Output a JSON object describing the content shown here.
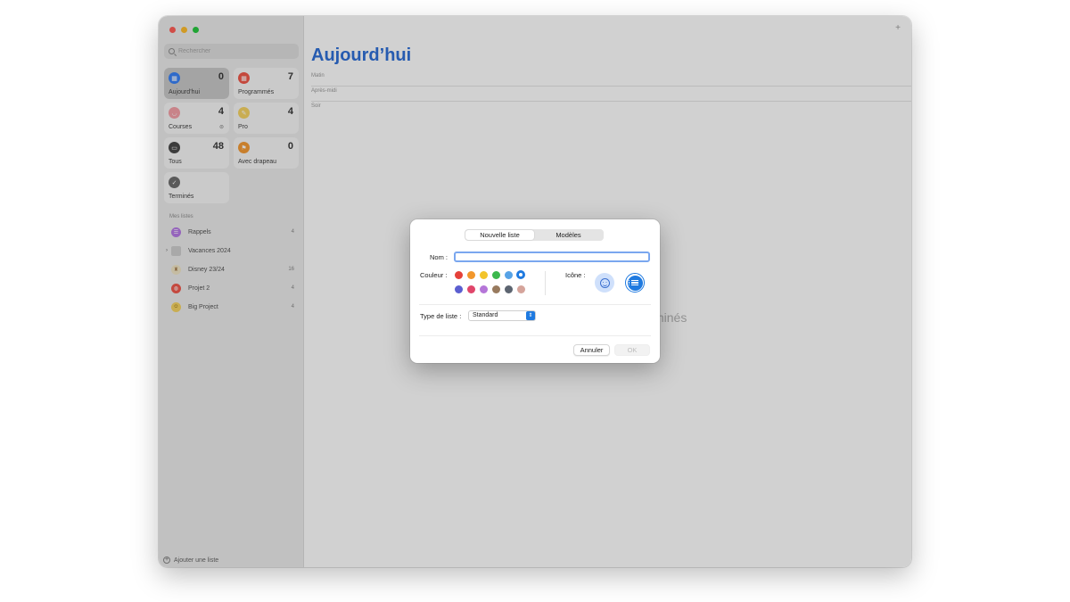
{
  "window": {
    "traffic_colors": [
      "#ff5f57",
      "#febc2e",
      "#28c840"
    ]
  },
  "sidebar": {
    "search_placeholder": "Rechercher",
    "smart_lists": [
      {
        "label": "Aujourd’hui",
        "count": "0",
        "icon": "calendar-icon",
        "color": "#3a82f7",
        "selected": true
      },
      {
        "label": "Programmés",
        "count": "7",
        "icon": "calendar-icon",
        "color": "#f0584a"
      },
      {
        "label": "Courses",
        "count": "4",
        "icon": "basket-icon",
        "color": "#f4a0a8",
        "sublabel": "⊜"
      },
      {
        "label": "Pro",
        "count": "4",
        "icon": "pencil-icon",
        "color": "#f6d465"
      },
      {
        "label": "Tous",
        "count": "48",
        "icon": "tray-icon",
        "color": "#4a4a4a"
      },
      {
        "label": "Avec drapeau",
        "count": "0",
        "icon": "flag-icon",
        "color": "#f59b36"
      },
      {
        "label": "Terminés",
        "count": "",
        "icon": "checkmark-icon",
        "color": "#6e6e6e"
      }
    ],
    "section_title": "Mes listes",
    "lists": [
      {
        "name": "Rappels",
        "count": "4",
        "icon": "list-icon",
        "color": "#b67ae6"
      },
      {
        "name": "Vacances 2024",
        "count": "",
        "icon": "folder-icon",
        "color": "#cfcfcf"
      },
      {
        "name": "Disney 23/24",
        "count": "16",
        "icon": "castle-icon",
        "color": "#f1e6c6"
      },
      {
        "name": "Projet 2",
        "count": "4",
        "icon": "gamepad-icon",
        "color": "#ef5a4e"
      },
      {
        "name": "Big Project",
        "count": "4",
        "icon": "emoji-icon",
        "color": "#f6d465"
      }
    ],
    "add_list_label": "Ajouter une liste"
  },
  "main": {
    "title": "Aujourd’hui",
    "title_color": "#2f6fd7",
    "sections": [
      "Matin",
      "Après-midi",
      "Soir"
    ],
    "empty_text": "minés",
    "add_icon": "plus-icon"
  },
  "dialog": {
    "tabs": [
      "Nouvelle liste",
      "Modèles"
    ],
    "active_tab": "Nouvelle liste",
    "name_label": "Nom :",
    "name_value": "",
    "color_label": "Couleur :",
    "colors_row1": [
      "#e5413a",
      "#f2972c",
      "#f2c42c",
      "#3cb84d",
      "#57a3e6",
      "#1f7ae0"
    ],
    "colors_row2": [
      "#5b5ed0",
      "#e0466a",
      "#b576d8",
      "#987a5e",
      "#5c6470",
      "#d5a49b"
    ],
    "selected_color": "#1f7ae0",
    "icon_label": "Icône :",
    "icon_options": [
      "emoji-icon",
      "list-bullet-icon"
    ],
    "list_type_label": "Type de liste :",
    "list_type_value": "Standard",
    "cancel_label": "Annuler",
    "ok_label": "OK"
  }
}
